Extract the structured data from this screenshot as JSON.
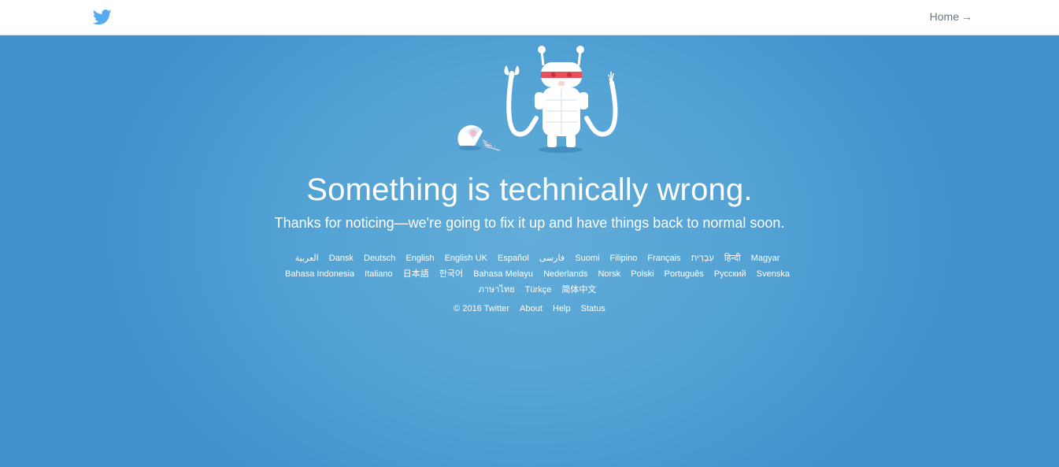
{
  "header": {
    "logo_icon": "twitter-bird-icon",
    "home_label": "Home",
    "home_arrow": "→"
  },
  "illustration": {
    "icon": "broken-robot-icon"
  },
  "message": {
    "title": "Something is technically wrong.",
    "subtitle": "Thanks for noticing—we're going to fix it up and have things back to normal soon."
  },
  "languages": [
    "العربية",
    "Dansk",
    "Deutsch",
    "English",
    "English UK",
    "Español",
    "فارسی",
    "Suomi",
    "Filipino",
    "Français",
    "עִבְרִית",
    "हिन्दी",
    "Magyar",
    "Bahasa Indonesia",
    "Italiano",
    "日本語",
    "한국어",
    "Bahasa Melayu",
    "Nederlands",
    "Norsk",
    "Polski",
    "Português",
    "Русский",
    "Svenska",
    "ภาษาไทย",
    "Türkçe",
    "简体中文"
  ],
  "footer": {
    "copyright": "© 2016 Twitter",
    "links": [
      "About",
      "Help",
      "Status"
    ]
  },
  "colors": {
    "background_center": "#62acd9",
    "background_edge": "#3f92cc",
    "brand_blue": "#55acee",
    "robot_visor": "#e8505b",
    "text": "#ffffff"
  }
}
